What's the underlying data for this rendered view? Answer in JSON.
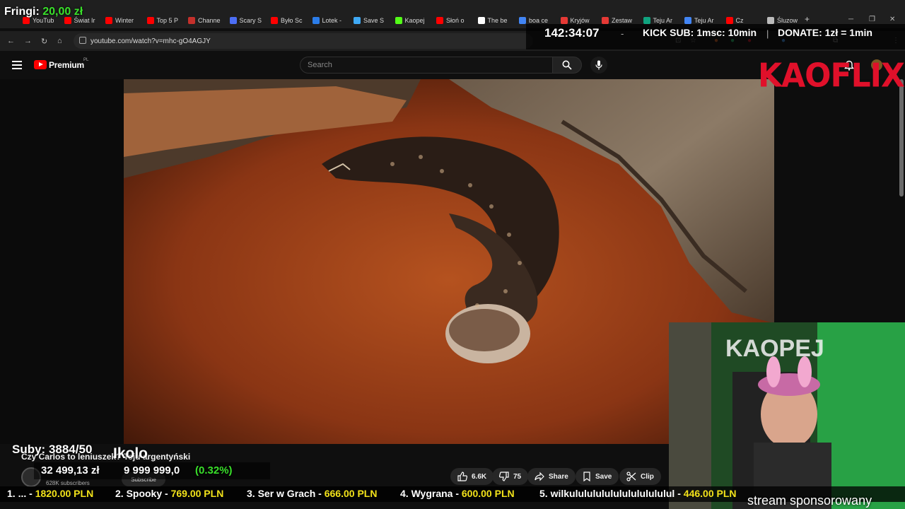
{
  "browser": {
    "tabs": [
      {
        "label": "YouTub",
        "color": "#ff0000"
      },
      {
        "label": "Świat Ir",
        "color": "#ff0000"
      },
      {
        "label": "Winter",
        "color": "#ff0000"
      },
      {
        "label": "Top 5 P",
        "color": "#ff0000"
      },
      {
        "label": "Channe",
        "color": "#c4302b"
      },
      {
        "label": "Scary S",
        "color": "#4c6ef5"
      },
      {
        "label": "Było Sc",
        "color": "#ff0000"
      },
      {
        "label": "Lotek -",
        "color": "#2b7de9"
      },
      {
        "label": "Save S",
        "color": "#3fa9f5"
      },
      {
        "label": "Kaopej",
        "color": "#53fc18"
      },
      {
        "label": "Słoń o",
        "color": "#ff0000"
      },
      {
        "label": "The be",
        "color": "#ffffff"
      },
      {
        "label": "boa ce",
        "color": "#4285f4"
      },
      {
        "label": "Kryjów",
        "color": "#e53935"
      },
      {
        "label": "Zestaw",
        "color": "#e53935"
      },
      {
        "label": "Teju Ar",
        "color": "#10a37f"
      },
      {
        "label": "Teju Ar",
        "color": "#4285f4"
      },
      {
        "label": "Cz",
        "color": "#ff0000"
      },
      {
        "label": "Śluzow",
        "color": "#bbbbbb"
      }
    ],
    "new_tab": "+",
    "url": "youtube.com/watch?v=mhc-gO4AGJY"
  },
  "youtube": {
    "brand": "Premium",
    "region": "PL",
    "search_placeholder": "Search",
    "video_title": "Czy Carlos to leniuszek? Teju argentyński",
    "channel_subscribers": "628K subscribers",
    "subscribe_label": "Subscribe",
    "actions": {
      "likes": "6.6K",
      "dislikes": "75",
      "share": "Share",
      "save": "Save",
      "clip": "Clip"
    }
  },
  "stream": {
    "fringi_label": "Fringi:",
    "fringi_value": "20,00 zł",
    "timer": "142:34:07",
    "separator": "-",
    "kick_sub": "KICK SUB: 1msc: 10min",
    "bar": "|",
    "donate": "DONATE: 1zł = 1min",
    "logo": "KAOFLIX",
    "suby": "Suby: 3884/50",
    "ikolo": "Ikolo",
    "money": "32 499,13 zł",
    "goal": "9 999 999,0",
    "goal_pct": "(0.32%)",
    "leaderboard": [
      {
        "rank": "1. ...",
        "amount": "1820.00 PLN"
      },
      {
        "rank": "2. Spooky",
        "amount": "769.00 PLN"
      },
      {
        "rank": "3. Ser w Grach",
        "amount": "666.00 PLN"
      },
      {
        "rank": "4. Wygrana",
        "amount": "600.00 PLN"
      },
      {
        "rank": "5. wilkulululululululululululul",
        "amount": "446.00 PLN"
      }
    ],
    "sponsor_text": "stream sponsorowany",
    "webcam_sign": "KAOPEJ"
  },
  "colors": {
    "accent_green": "#39e02a",
    "logo_red": "#e0102a",
    "leader_gold": "#f2e21a",
    "youtube_red": "#ff0000"
  }
}
